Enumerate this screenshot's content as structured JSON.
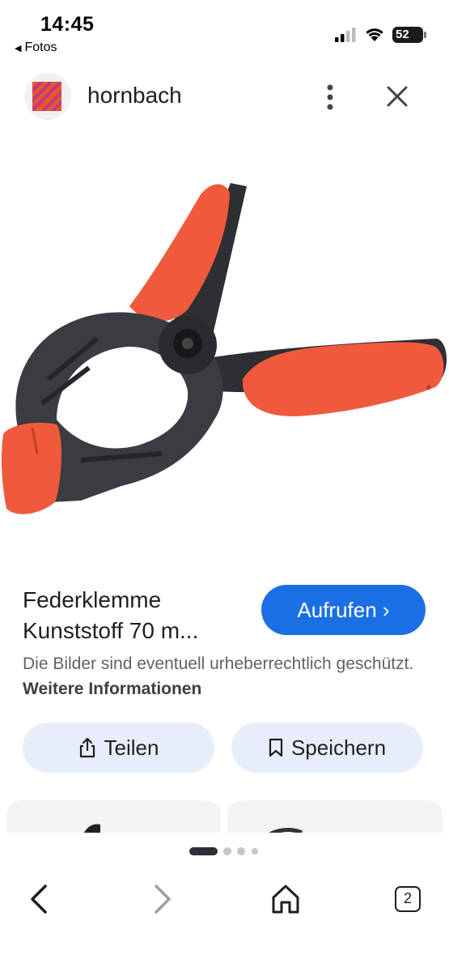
{
  "status_bar": {
    "time": "14:45",
    "back_app": "Fotos",
    "battery": "52"
  },
  "header": {
    "site_name": "hornbach",
    "logo_color": "#e8572a"
  },
  "result": {
    "title": "Federklemme Kunststoff 70 m...",
    "visit_label": "Aufrufen",
    "copyright_text": "Die Bilder sind eventuell urheberrechtlich geschützt.",
    "more_info_label": "Weitere Informationen",
    "share_label": "Teilen",
    "save_label": "Speichern",
    "accent_color": "#1b6fe4"
  },
  "pager": {
    "pages": 4,
    "active": 0
  },
  "nav": {
    "tab_count": "2"
  }
}
